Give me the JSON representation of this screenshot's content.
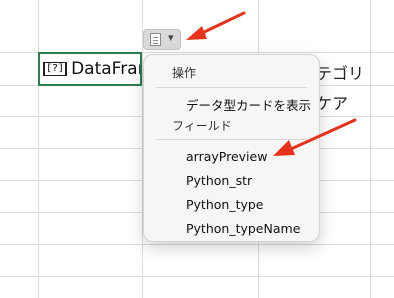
{
  "spreadsheet": {
    "selected_cell_text": "DataFrar",
    "selected_cell_icon": "[?]",
    "right_cells": [
      "テゴリ",
      "ケア"
    ]
  },
  "card_button": {
    "icon": "card-icon",
    "chevron": "▾"
  },
  "menu": {
    "section_action": "操作",
    "show_data_type_card": "データ型カードを表示",
    "section_field": "フィールド",
    "fields": [
      "arrayPreview",
      "Python_str",
      "Python_type",
      "Python_typeName"
    ]
  },
  "colors": {
    "selection_border": "#2e7d4f",
    "annotation_arrow": "#e8321c"
  }
}
